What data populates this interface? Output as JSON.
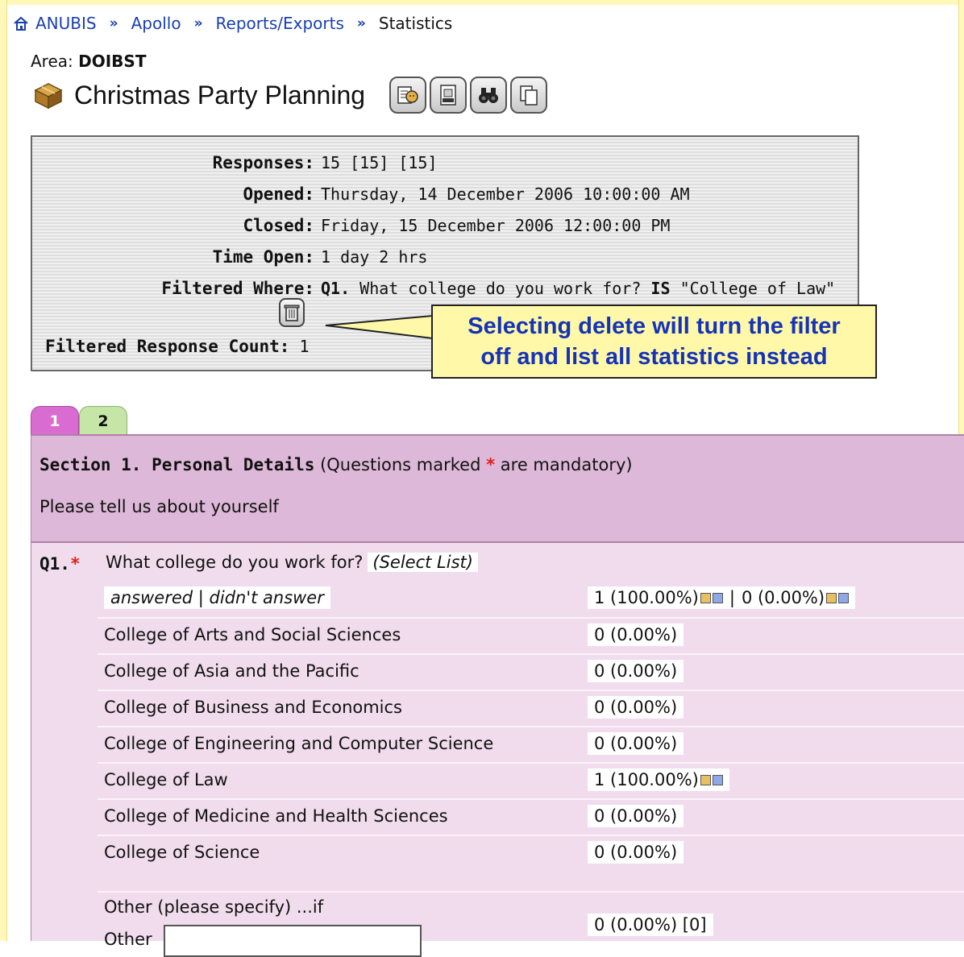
{
  "breadcrumb": {
    "items": [
      "ANUBIS",
      "Apollo",
      "Reports/Exports"
    ],
    "current": "Statistics",
    "separator": "»"
  },
  "area": {
    "label": "Area:",
    "value": "DOIBST"
  },
  "survey": {
    "title": "Christmas Party Planning"
  },
  "toolbar": {
    "icons": [
      "report-icon",
      "csv-export-icon",
      "binoculars-icon",
      "copy-icon"
    ]
  },
  "info": {
    "responses_label": "Responses:",
    "responses_value": "15 [15] [15]",
    "opened_label": "Opened:",
    "opened_value": "Thursday, 14 December 2006 10:00:00 AM",
    "closed_label": "Closed:",
    "closed_value": "Friday, 15 December 2006 12:00:00 PM",
    "time_open_label": "Time Open:",
    "time_open_value": "1 day 2 hrs",
    "filtered_where_label": "Filtered Where:",
    "filter_q": "Q1.",
    "filter_text": "What college do you work for?",
    "filter_is": "IS",
    "filter_value": "\"College of Law\"",
    "filtered_count_label": "Filtered Response Count:",
    "filtered_count_value": "1"
  },
  "callout": {
    "line1": "Selecting delete will turn the filter",
    "line2": "off and list all statistics instead"
  },
  "tabs": [
    "1",
    "2"
  ],
  "section": {
    "title": "Section 1. Personal Details",
    "note_pre": "(Questions marked",
    "note_star": "*",
    "note_post": "are mandatory)",
    "description": "Please tell us about yourself"
  },
  "question": {
    "number": "Q1.",
    "star": "*",
    "text": "What college do you work for?",
    "type": "(Select List)",
    "answered_header": "answered | didn't answer",
    "answered_a": "1 (100.00%)",
    "answered_sep": "|",
    "answered_b": "0 (0.00%)",
    "options": [
      {
        "label": "College of Arts and Social Sciences",
        "value": "0 (0.00%)"
      },
      {
        "label": "College of Asia and the Pacific",
        "value": "0 (0.00%)"
      },
      {
        "label": "College of Business and Economics",
        "value": "0 (0.00%)"
      },
      {
        "label": "College of Engineering and Computer Science",
        "value": "0 (0.00%)"
      },
      {
        "label": "College of Law",
        "value": "1 (100.00%)"
      },
      {
        "label": "College of Medicine and Health Sciences",
        "value": "0 (0.00%)"
      },
      {
        "label": "College of Science",
        "value": "0 (0.00%)"
      }
    ],
    "other_label": "Other (please specify) ...if",
    "other_field_label": "Other",
    "other_value": "0 (0.00%) [0]"
  },
  "colors": {
    "frame": "#fff8b8",
    "link": "#1a3fb0",
    "callout_bg": "#fff8a8",
    "callout_text": "#1533b8",
    "tab_active": "#d96cd0",
    "tab_inactive": "#c6e6a8",
    "section_bg": "#ddb8d8",
    "question_bg": "#f0dcec",
    "mandatory_star": "#e0201a"
  }
}
